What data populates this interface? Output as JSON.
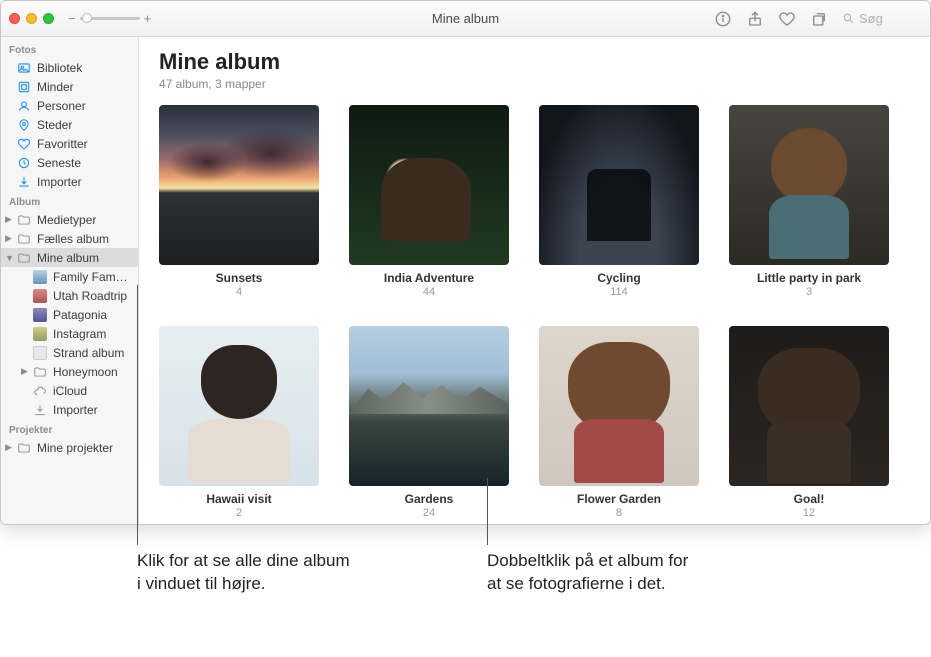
{
  "window_title": "Mine album",
  "toolbar": {
    "zoom_minus": "−",
    "zoom_plus": "+",
    "search_placeholder": "Søg"
  },
  "sidebar": {
    "sections": {
      "fotos": "Fotos",
      "album": "Album",
      "projekter": "Projekter"
    },
    "fotos_items": [
      {
        "label": "Bibliotek"
      },
      {
        "label": "Minder"
      },
      {
        "label": "Personer"
      },
      {
        "label": "Steder"
      },
      {
        "label": "Favoritter"
      },
      {
        "label": "Seneste"
      },
      {
        "label": "Importer"
      }
    ],
    "album_items": [
      {
        "label": "Medietyper",
        "disclosure": ">"
      },
      {
        "label": "Fælles album",
        "disclosure": ">"
      },
      {
        "label": "Mine album",
        "disclosure": "v",
        "selected": true
      }
    ],
    "mine_children": [
      {
        "label": "Family Family…"
      },
      {
        "label": "Utah Roadtrip"
      },
      {
        "label": "Patagonia"
      },
      {
        "label": "Instagram"
      },
      {
        "label": "Strand album"
      },
      {
        "label": "Honeymoon",
        "disclosure": ">",
        "folder": true
      },
      {
        "label": "iCloud",
        "cloud": true
      },
      {
        "label": "Importer",
        "download": true
      }
    ],
    "projekter_items": [
      {
        "label": "Mine projekter",
        "disclosure": ">"
      }
    ]
  },
  "page": {
    "title": "Mine album",
    "subtitle": "47 album, 3 mapper"
  },
  "albums": [
    {
      "name": "Sunsets",
      "count": "4",
      "thumb": "th-sunset"
    },
    {
      "name": "India Adventure",
      "count": "44",
      "thumb": "th-india"
    },
    {
      "name": "Cycling",
      "count": "114",
      "thumb": "th-cycling"
    },
    {
      "name": "Little party in park",
      "count": "3",
      "thumb": "th-party"
    },
    {
      "name": "Hawaii visit",
      "count": "2",
      "thumb": "th-hawaii"
    },
    {
      "name": "Gardens",
      "count": "24",
      "thumb": "th-gardens"
    },
    {
      "name": "Flower Garden",
      "count": "8",
      "thumb": "th-flower"
    },
    {
      "name": "Goal!",
      "count": "12",
      "thumb": "th-goal"
    }
  ],
  "callouts": {
    "left": "Klik for at se alle dine album i vinduet til højre.",
    "right": "Dobbeltklik på et album for at se fotografierne i det."
  }
}
